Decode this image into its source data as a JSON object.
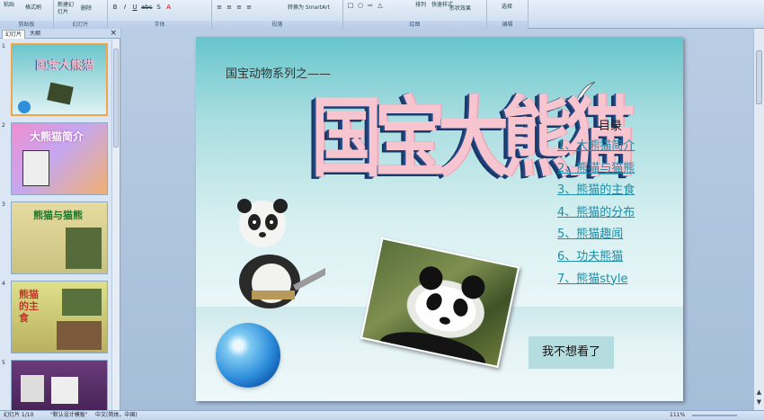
{
  "ribbon": {
    "groups": [
      {
        "label": "剪贴板"
      },
      {
        "label": "幻灯片"
      },
      {
        "label": "字体"
      },
      {
        "label": "段落"
      },
      {
        "label": "绘图"
      },
      {
        "label": "编辑"
      }
    ],
    "paste": "粘贴",
    "format_painter": "格式刷",
    "new_slide": "新建幻灯片",
    "delete": "删除",
    "smartart": "转换为 SmartArt",
    "arrange": "排列",
    "quick_styles": "快速样式",
    "shape_effects": "形状效果",
    "select": "选择"
  },
  "panel": {
    "tab_slides": "幻灯片",
    "tab_outline": "大纲",
    "close": "×",
    "slide_numbers": [
      "1",
      "2",
      "3",
      "4",
      "5"
    ]
  },
  "slide": {
    "series": "国宝动物系列之——",
    "title": "国宝大熊猫",
    "toc_title": "目录",
    "toc": [
      "1、大熊猫简介",
      "2、熊猫与猫熊",
      "3、熊猫的主食",
      "4、熊猫的分布",
      "5、熊猫趣闻",
      "6、功夫熊猫",
      "7、熊猫style"
    ],
    "button": "我不想看了"
  },
  "thumbs": {
    "t1_title": "国宝大熊猫",
    "t2_title": "大熊猫简介",
    "t3_title": "熊猫与猫熊",
    "t4_title": "熊猫的主食"
  },
  "status": {
    "slide_index": "幻灯片 1/10",
    "template": "\"默认设计模板\"",
    "language": "中文(简体，中国)",
    "zoom": "111%"
  }
}
